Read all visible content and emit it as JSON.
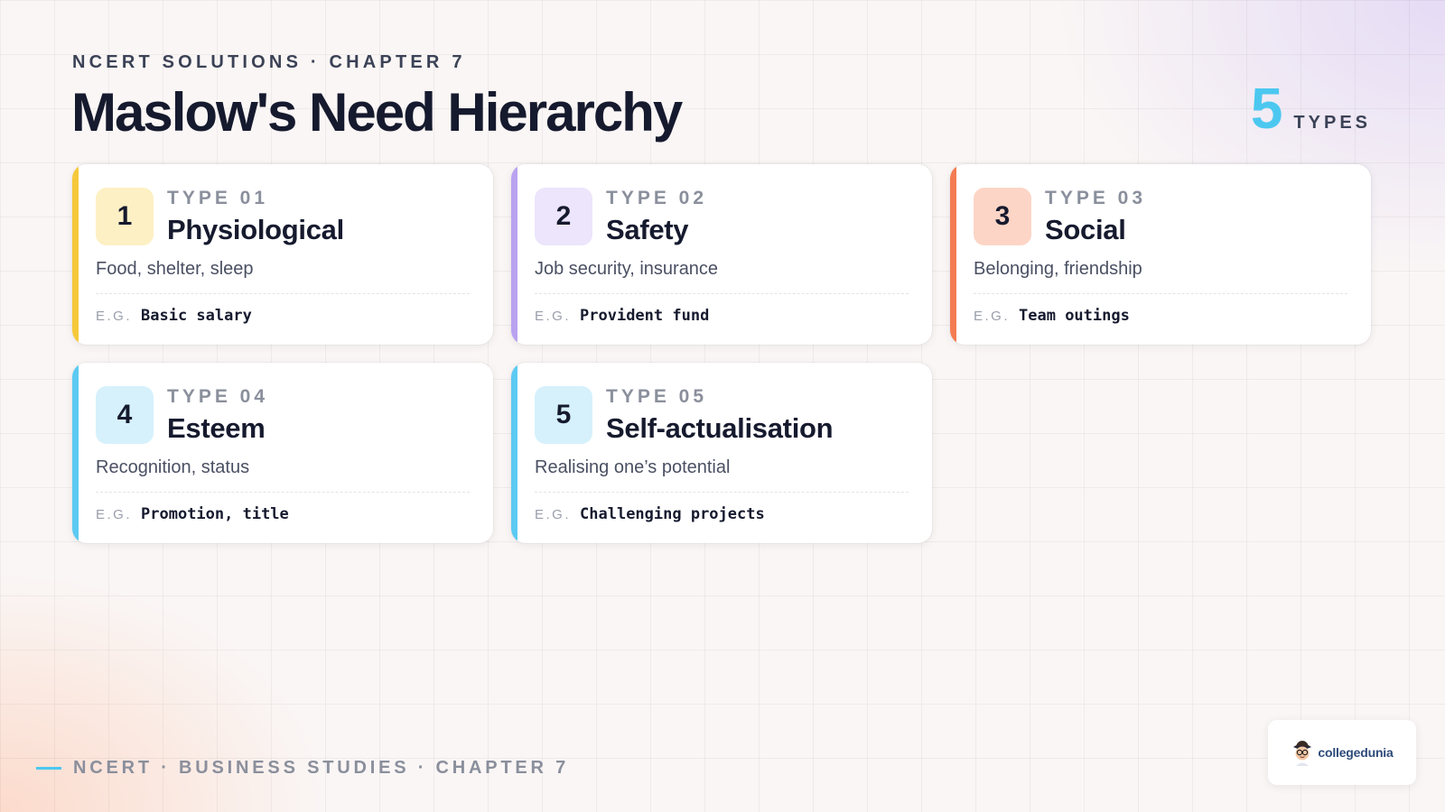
{
  "header": {
    "eyebrow": "NCERT SOLUTIONS · CHAPTER 7",
    "title": "Maslow's Need Hierarchy",
    "count_number": "5",
    "count_label": "TYPES"
  },
  "cards": [
    {
      "number": "1",
      "type_label": "TYPE 01",
      "title": "Physiological",
      "description": "Food, shelter, sleep",
      "eg_label": "E.G.",
      "example": "Basic salary",
      "accent_color": "#f5c93a",
      "badge_bg": "#fdf0c4"
    },
    {
      "number": "2",
      "type_label": "TYPE 02",
      "title": "Safety",
      "description": "Job security, insurance",
      "eg_label": "E.G.",
      "example": "Provident fund",
      "accent_color": "#b9a2f0",
      "badge_bg": "#ece5fb"
    },
    {
      "number": "3",
      "type_label": "TYPE 03",
      "title": "Social",
      "description": "Belonging, friendship",
      "eg_label": "E.G.",
      "example": "Team outings",
      "accent_color": "#f47c52",
      "badge_bg": "#fdd5c6"
    },
    {
      "number": "4",
      "type_label": "TYPE 04",
      "title": "Esteem",
      "description": "Recognition, status",
      "eg_label": "E.G.",
      "example": "Promotion, title",
      "accent_color": "#5ccaf2",
      "badge_bg": "#d6f1fc"
    },
    {
      "number": "5",
      "type_label": "TYPE 05",
      "title": "Self-actualisation",
      "description": "Realising one’s potential",
      "eg_label": "E.G.",
      "example": "Challenging projects",
      "accent_color": "#5ccaf2",
      "badge_bg": "#d6f1fc"
    }
  ],
  "footer": {
    "text": "NCERT · BUSINESS STUDIES · CHAPTER 7"
  },
  "logo": {
    "text": "collegedunia",
    "icon": "mascot-icon"
  }
}
